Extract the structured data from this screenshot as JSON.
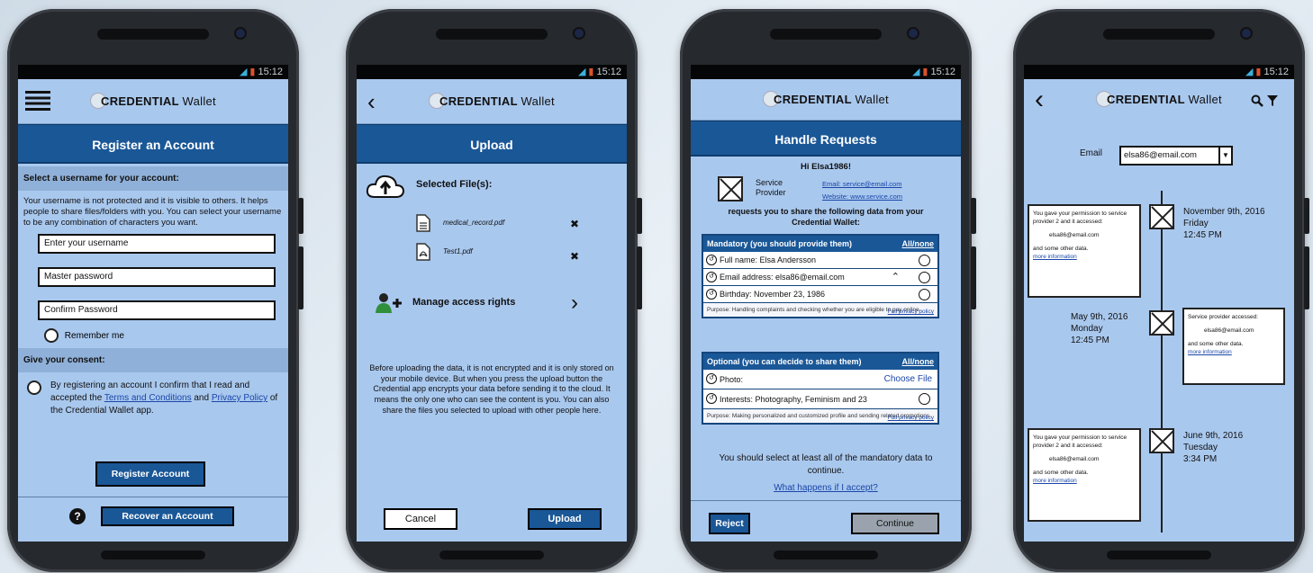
{
  "status_time": "15:12",
  "logo": {
    "brand": "CREDENTIAL",
    "suffix": "Wallet"
  },
  "phone1": {
    "title": "Register an Account",
    "section_username": "Select a username for your account:",
    "info": "Your username is not protected and it is visible to others. It helps people to share files/folders with you. You can select your username to be any combination of characters you want.",
    "username_placeholder": "Enter your username",
    "password_placeholder": "Master password",
    "confirm_placeholder": "Confirm Password",
    "remember": "Remember me",
    "section_consent": "Give your consent:",
    "consent_pre": "By registering an account I confirm that I read and accepted the",
    "terms": "Terms and Conditions",
    "and": "and",
    "privacy": "Privacy Policy",
    "consent_post": "of the Credential Wallet app.",
    "register_btn": "Register Account",
    "help": "?",
    "recover_btn": "Recover an Account"
  },
  "phone2": {
    "title": "Upload",
    "selected": "Selected File(s):",
    "files": [
      "medical_record.pdf",
      "Test1.pdf"
    ],
    "remove": "✖",
    "manage": "Manage access rights",
    "info": "Before uploading the data, it is not encrypted and it is only stored on your mobile device. But when you press the upload button the Credential app encrypts your data before sending it to the cloud. It means the only one who can see the content is you. You can also share the files you selected to upload with other people here.",
    "cancel": "Cancel",
    "upload": "Upload"
  },
  "phone3": {
    "title": "Handle Requests",
    "greeting": "Hi Elsa1986!",
    "provider": "Service Provider",
    "email": "Email: service@email.com",
    "website": "Website: www.service.com",
    "request": "requests you to share the following data from your Credential Wallet:",
    "mandatory_header": "Mandatory (you should provide them)",
    "all_none": "All/none",
    "mandatory_rows": [
      "Full name: Elsa Andersson",
      "Email address: elsa86@email.com",
      "Birthday: November 23, 1986"
    ],
    "purpose1": "Purpose: Handling complaints and checking whether you are eligible to pay online.",
    "full_privacy": "Full privacy policy",
    "optional_header": "Optional (you can decide to share them)",
    "photo": "Photo:",
    "choose_file": "Choose File",
    "interests": "Interests: Photography, Feminism and 23",
    "purpose2": "Purpose: Making personalized and customized profile and sending related promotions.",
    "notice": "You should select at least all of the mandatory data to continue.",
    "what_happens": "What happens if I accept?",
    "reject": "Reject",
    "continue": "Continue"
  },
  "phone4": {
    "email_label": "Email",
    "email_value": "elsa86@email.com",
    "entries": [
      {
        "date": [
          "November 9th, 2016",
          "Friday",
          "12:45 PM"
        ],
        "card": [
          "You gave your permission to service provider 2 and it accessed:",
          "elsa86@email.com",
          "and some other data.",
          "more information"
        ]
      },
      {
        "date": [
          "May 9th, 2016",
          "Monday",
          "12:45 PM"
        ],
        "card": [
          "Service provider accessed:",
          "elsa86@email.com",
          "and some other data.",
          "more information"
        ]
      },
      {
        "date": [
          "June 9th, 2016",
          "Tuesday",
          "3:34 PM"
        ],
        "card": [
          "You gave your permission to service provider 2 and it accessed:",
          "elsa86@email.com",
          "and some other data.",
          "more information"
        ]
      }
    ]
  }
}
